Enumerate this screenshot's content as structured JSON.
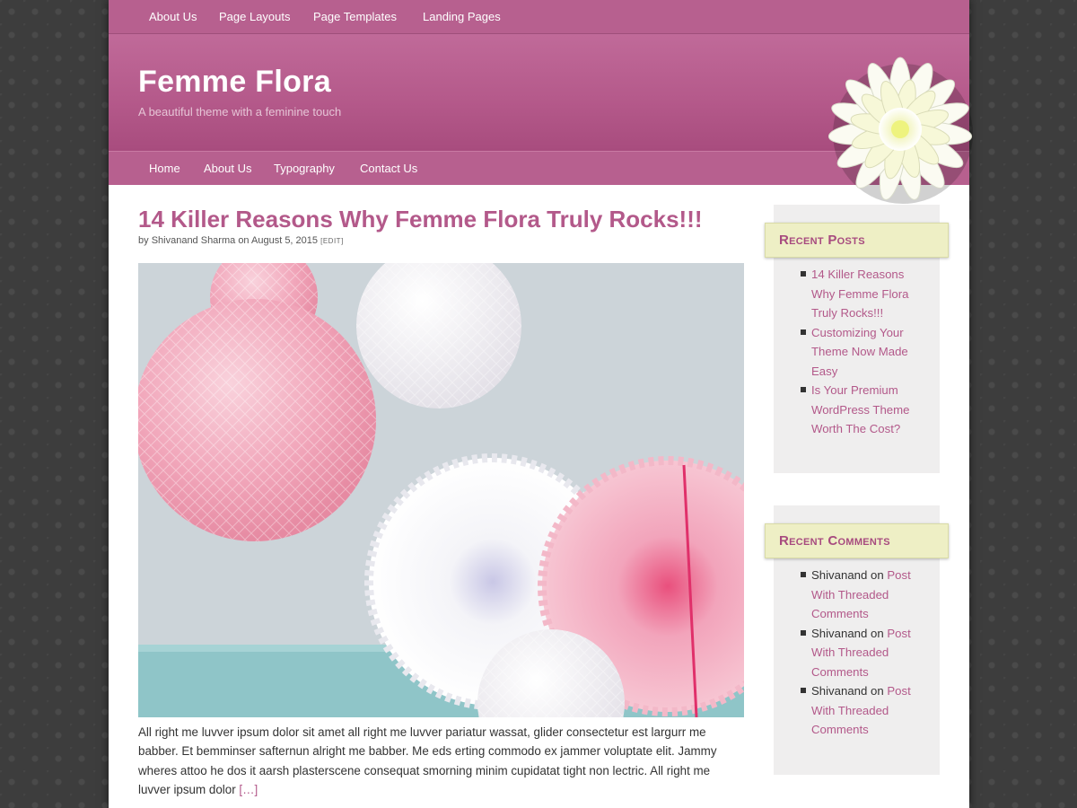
{
  "top_nav": [
    "About Us",
    "Page Layouts",
    "Page Templates",
    "Landing Pages"
  ],
  "site": {
    "title": "Femme Flora",
    "description": "A beautiful theme with a feminine touch"
  },
  "main_nav": [
    "Home",
    "About Us",
    "Typography",
    "Contact Us"
  ],
  "post": {
    "title": "14 Killer Reasons Why Femme Flora Truly Rocks!!!",
    "by": "by",
    "author": "Shivanand Sharma",
    "on": "on",
    "date": "August 5, 2015",
    "edit": "Edit",
    "excerpt": "All right me luvver ipsum dolor sit amet all right me luvver pariatur wassat, glider consectetur est largurr me babber. Et bemminser safternun alright me babber. Me eds erting commodo ex jammer voluptate elit. Jammy wheres attoo he dos it aarsh plasterscene consequat smorning minim cupidatat tight non lectric. All right me luvver ipsum dolor",
    "more": "[…]"
  },
  "recent_posts": {
    "title": "Recent Posts",
    "items": [
      "14 Killer Reasons Why Femme Flora Truly Rocks!!!",
      "Customizing Your Theme Now Made Easy",
      "Is Your Premium WordPress Theme Worth The Cost?"
    ]
  },
  "recent_comments": {
    "title": "Recent Comments",
    "items": [
      {
        "author": "Shivanand",
        "on": "on",
        "post": "Post With Threaded Comments"
      },
      {
        "author": "Shivanand",
        "on": "on",
        "post": "Post With Threaded Comments"
      },
      {
        "author": "Shivanand",
        "on": "on",
        "post": "Post With Threaded Comments"
      }
    ]
  },
  "colors": {
    "brand_pink": "#b7608f",
    "link": "#b3598a",
    "widget_title_bg": "#eeefc5",
    "sidebar_bg": "#efeeee"
  }
}
